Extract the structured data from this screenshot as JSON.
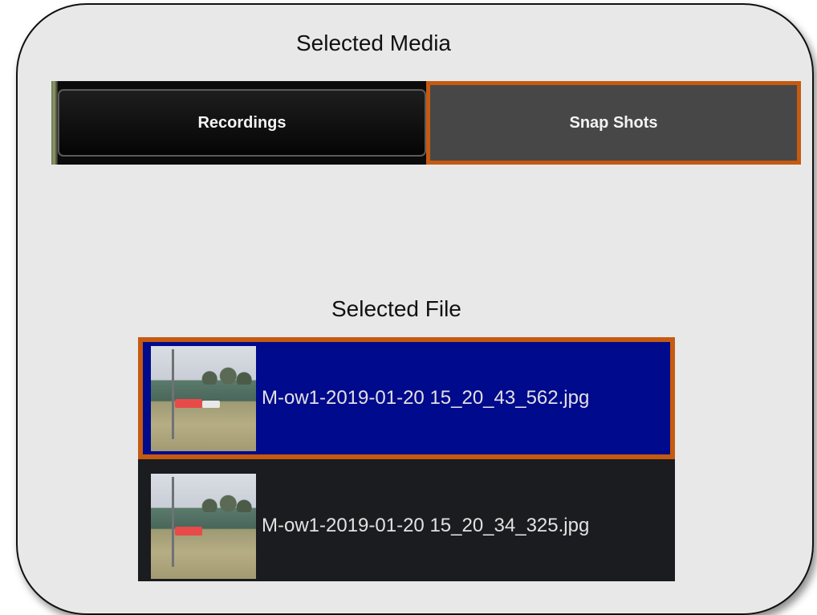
{
  "selected_media_heading": "Selected Media",
  "tabs": {
    "recordings": "Recordings",
    "snapshots": "Snap Shots",
    "active": "snapshots"
  },
  "selected_file_heading": "Selected File",
  "files": [
    {
      "name": "M-ow1-2019-01-20 15_20_43_562.jpg",
      "selected": true
    },
    {
      "name": "M-ow1-2019-01-20 15_20_34_325.jpg",
      "selected": false
    }
  ],
  "colors": {
    "highlight": "#c55a11",
    "selected_row": "#000a8c",
    "row": "#1a1c1f"
  }
}
